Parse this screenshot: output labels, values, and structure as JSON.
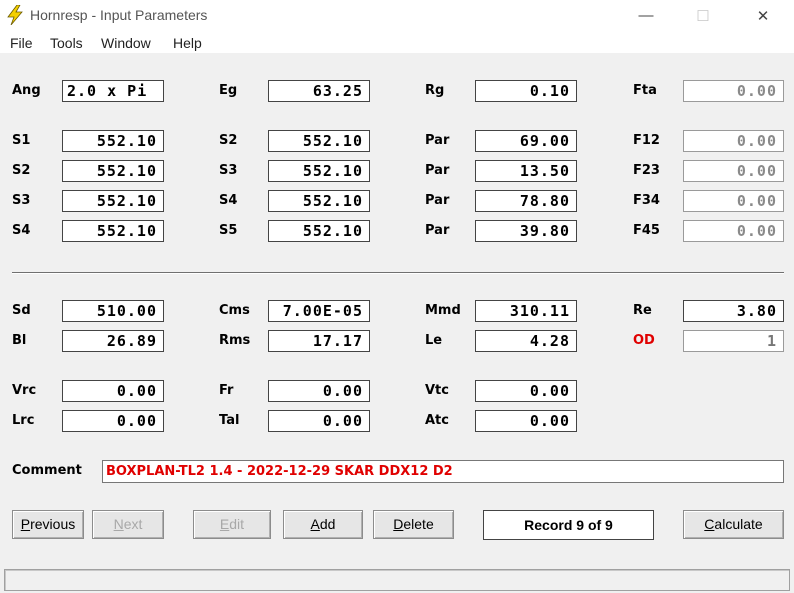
{
  "window": {
    "title": "Hornresp - Input Parameters",
    "minimize_glyph": "—",
    "maximize_glyph": "☐",
    "close_glyph": "✕",
    "icon": "lightning-bolt-icon",
    "icon_color": "#f5d000"
  },
  "menu": {
    "items": [
      "File",
      "Tools",
      "Window",
      "Help"
    ]
  },
  "row_ang": {
    "ang": {
      "label": "Ang",
      "value": "2.0 x Pi"
    },
    "eg": {
      "label": "Eg",
      "value": "63.25"
    },
    "rg": {
      "label": "Rg",
      "value": "0.10"
    },
    "fta": {
      "label": "Fta",
      "value": "0.00"
    }
  },
  "horn": [
    {
      "s_label": "S1",
      "s_value": "552.10",
      "s2_label": "S2",
      "s2_value": "552.10",
      "par_label": "Par",
      "par_value": "69.00",
      "f_label": "F12",
      "f_value": "0.00"
    },
    {
      "s_label": "S2",
      "s_value": "552.10",
      "s2_label": "S3",
      "s2_value": "552.10",
      "par_label": "Par",
      "par_value": "13.50",
      "f_label": "F23",
      "f_value": "0.00"
    },
    {
      "s_label": "S3",
      "s_value": "552.10",
      "s2_label": "S4",
      "s2_value": "552.10",
      "par_label": "Par",
      "par_value": "78.80",
      "f_label": "F34",
      "f_value": "0.00"
    },
    {
      "s_label": "S4",
      "s_value": "552.10",
      "s2_label": "S5",
      "s2_value": "552.10",
      "par_label": "Par",
      "par_value": "39.80",
      "f_label": "F45",
      "f_value": "0.00"
    }
  ],
  "driver": {
    "sd": {
      "label": "Sd",
      "value": "510.00"
    },
    "cms": {
      "label": "Cms",
      "value": "7.00E-05"
    },
    "mmd": {
      "label": "Mmd",
      "value": "310.11"
    },
    "re": {
      "label": "Re",
      "value": "3.80"
    },
    "bl": {
      "label": "Bl",
      "value": "26.89"
    },
    "rms": {
      "label": "Rms",
      "value": "17.17"
    },
    "le": {
      "label": "Le",
      "value": "4.28"
    },
    "od": {
      "label": "OD",
      "value": "1",
      "label_color": "#e00000"
    }
  },
  "chambers": {
    "vrc": {
      "label": "Vrc",
      "value": "0.00"
    },
    "fr": {
      "label": "Fr",
      "value": "0.00"
    },
    "vtc": {
      "label": "Vtc",
      "value": "0.00"
    },
    "lrc": {
      "label": "Lrc",
      "value": "0.00"
    },
    "tal": {
      "label": "Tal",
      "value": "0.00"
    },
    "atc": {
      "label": "Atc",
      "value": "0.00"
    }
  },
  "comment": {
    "label": "Comment",
    "value": "BOXPLAN-TL2 1.4 - 2022-12-29 SKAR DDX12 D2",
    "text_color": "#e00000"
  },
  "buttons": {
    "previous": {
      "label_ul": "P",
      "label_rest": "revious",
      "enabled": true
    },
    "next": {
      "label_ul": "N",
      "label_rest": "ext",
      "enabled": false
    },
    "edit": {
      "label_ul": "E",
      "label_rest": "dit",
      "enabled": false
    },
    "add": {
      "label_ul": "A",
      "label_rest": "dd",
      "enabled": true
    },
    "delete": {
      "label_ul": "D",
      "label_rest": "elete",
      "enabled": true
    },
    "calculate": {
      "label_ul": "C",
      "label_rest": "alculate",
      "enabled": true
    }
  },
  "record": {
    "text": "Record 9 of 9"
  },
  "statusbar": {
    "text": ""
  }
}
